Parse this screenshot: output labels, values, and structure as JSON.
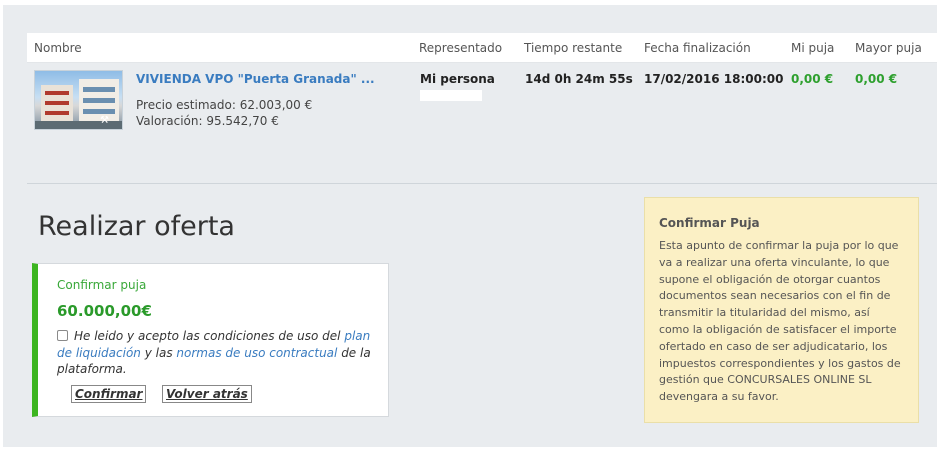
{
  "table": {
    "headers": {
      "nombre": "Nombre",
      "representado": "Representado",
      "tiempo": "Tiempo restante",
      "fecha": "Fecha finalización",
      "mi_puja": "Mi puja",
      "mayor_puja": "Mayor puja"
    },
    "row": {
      "title": "VIVIENDA VPO \"Puerta Granada\" ...",
      "precio": "Precio estimado: 62.003,00 €",
      "valoracion": "Valoración: 95.542,70 €",
      "representado": "Mi persona",
      "tiempo": "14d 0h 24m 55s",
      "fecha": "17/02/2016 18:00:00",
      "mi_puja": "0,00 €",
      "mayor_puja": "0,00 €"
    }
  },
  "offer": {
    "section_title": "Realizar oferta",
    "label": "Confirmar puja",
    "amount": "60.000,00€",
    "terms": {
      "t1": "He leido y acepto las condiciones de uso del",
      "link1": "plan de liquidación",
      "t2": "y las",
      "link2": "normas de uso contractual",
      "t3": "de la plataforma."
    },
    "confirm_label": "Confirmar",
    "back_label": "Volver atrás"
  },
  "info": {
    "title": "Confirmar Puja",
    "body": "Esta apunto de confirmar la puja por lo que va a realizar una oferta vinculante, lo que supone el obligación de otorgar cuantos documentos sean necesarios con el fin de transmitir la titularidad del mismo, así como la obligación de satisfacer el importe ofertado en caso de ser adjudicatario, los impuestos correspondientes y los gastos de gestión que CONCURSALES ONLINE SL devengara a su favor."
  },
  "colors": {
    "accent_green": "#3cb520",
    "link_blue": "#3a7cc0",
    "info_bg": "#fbf0c5"
  }
}
